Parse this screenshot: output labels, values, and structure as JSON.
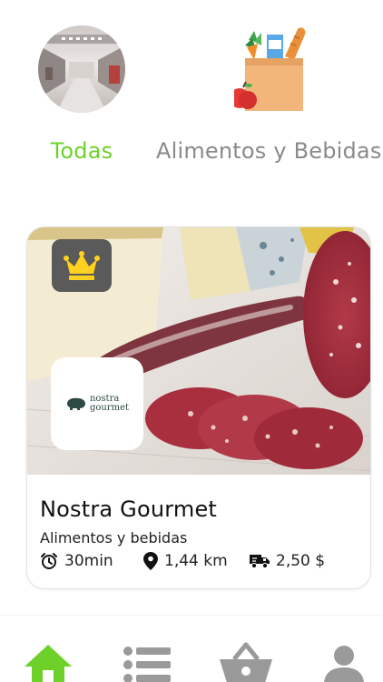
{
  "categories": [
    {
      "label": "Todas",
      "icon": "mall-photo",
      "active": true,
      "color": "#6dd12a"
    },
    {
      "label": "Alimentos y Bebidas",
      "icon": "grocery-bag-icon",
      "active": false,
      "color": "#8a8a8a"
    }
  ],
  "store": {
    "name": "Nostra Gourmet",
    "category": "Alimentos y bebidas",
    "delivery_time": "30min",
    "distance": "1,44 km",
    "delivery_fee": "2,50 $",
    "badge_icon": "crown-icon",
    "logo_text_1": "nostra",
    "logo_text_2": "gourmet"
  },
  "nav": {
    "items": [
      {
        "icon": "home-icon",
        "active": true,
        "color": "#6dd12a"
      },
      {
        "icon": "list-icon",
        "active": false,
        "color": "#9a9a9a"
      },
      {
        "icon": "basket-icon",
        "active": false,
        "color": "#9a9a9a"
      },
      {
        "icon": "user-icon",
        "active": false,
        "color": "#9a9a9a"
      }
    ]
  }
}
